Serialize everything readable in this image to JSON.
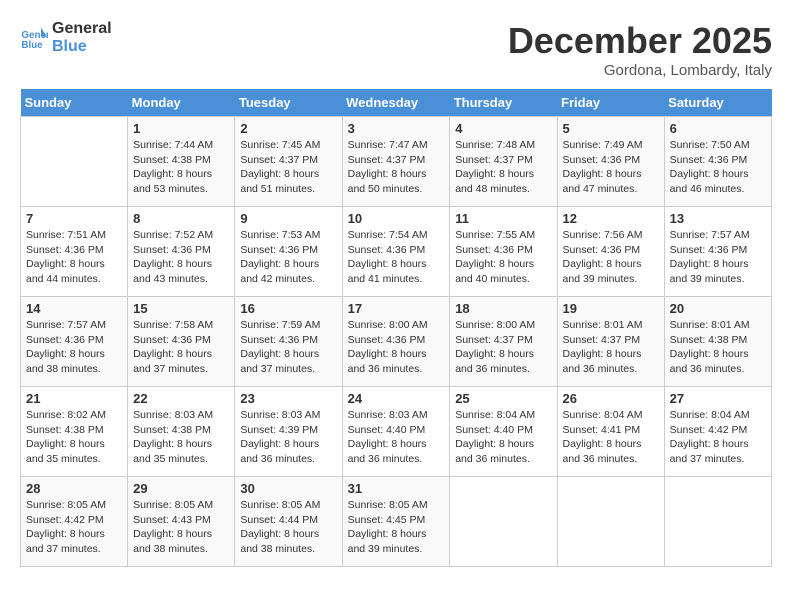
{
  "logo": {
    "line1": "General",
    "line2": "Blue"
  },
  "title": "December 2025",
  "location": "Gordona, Lombardy, Italy",
  "days_header": [
    "Sunday",
    "Monday",
    "Tuesday",
    "Wednesday",
    "Thursday",
    "Friday",
    "Saturday"
  ],
  "weeks": [
    [
      {
        "day": "",
        "sunrise": "",
        "sunset": "",
        "daylight": ""
      },
      {
        "day": "1",
        "sunrise": "7:44 AM",
        "sunset": "4:38 PM",
        "daylight": "8 hours and 53 minutes."
      },
      {
        "day": "2",
        "sunrise": "7:45 AM",
        "sunset": "4:37 PM",
        "daylight": "8 hours and 51 minutes."
      },
      {
        "day": "3",
        "sunrise": "7:47 AM",
        "sunset": "4:37 PM",
        "daylight": "8 hours and 50 minutes."
      },
      {
        "day": "4",
        "sunrise": "7:48 AM",
        "sunset": "4:37 PM",
        "daylight": "8 hours and 48 minutes."
      },
      {
        "day": "5",
        "sunrise": "7:49 AM",
        "sunset": "4:36 PM",
        "daylight": "8 hours and 47 minutes."
      },
      {
        "day": "6",
        "sunrise": "7:50 AM",
        "sunset": "4:36 PM",
        "daylight": "8 hours and 46 minutes."
      }
    ],
    [
      {
        "day": "7",
        "sunrise": "7:51 AM",
        "sunset": "4:36 PM",
        "daylight": "8 hours and 44 minutes."
      },
      {
        "day": "8",
        "sunrise": "7:52 AM",
        "sunset": "4:36 PM",
        "daylight": "8 hours and 43 minutes."
      },
      {
        "day": "9",
        "sunrise": "7:53 AM",
        "sunset": "4:36 PM",
        "daylight": "8 hours and 42 minutes."
      },
      {
        "day": "10",
        "sunrise": "7:54 AM",
        "sunset": "4:36 PM",
        "daylight": "8 hours and 41 minutes."
      },
      {
        "day": "11",
        "sunrise": "7:55 AM",
        "sunset": "4:36 PM",
        "daylight": "8 hours and 40 minutes."
      },
      {
        "day": "12",
        "sunrise": "7:56 AM",
        "sunset": "4:36 PM",
        "daylight": "8 hours and 39 minutes."
      },
      {
        "day": "13",
        "sunrise": "7:57 AM",
        "sunset": "4:36 PM",
        "daylight": "8 hours and 39 minutes."
      }
    ],
    [
      {
        "day": "14",
        "sunrise": "7:57 AM",
        "sunset": "4:36 PM",
        "daylight": "8 hours and 38 minutes."
      },
      {
        "day": "15",
        "sunrise": "7:58 AM",
        "sunset": "4:36 PM",
        "daylight": "8 hours and 37 minutes."
      },
      {
        "day": "16",
        "sunrise": "7:59 AM",
        "sunset": "4:36 PM",
        "daylight": "8 hours and 37 minutes."
      },
      {
        "day": "17",
        "sunrise": "8:00 AM",
        "sunset": "4:36 PM",
        "daylight": "8 hours and 36 minutes."
      },
      {
        "day": "18",
        "sunrise": "8:00 AM",
        "sunset": "4:37 PM",
        "daylight": "8 hours and 36 minutes."
      },
      {
        "day": "19",
        "sunrise": "8:01 AM",
        "sunset": "4:37 PM",
        "daylight": "8 hours and 36 minutes."
      },
      {
        "day": "20",
        "sunrise": "8:01 AM",
        "sunset": "4:38 PM",
        "daylight": "8 hours and 36 minutes."
      }
    ],
    [
      {
        "day": "21",
        "sunrise": "8:02 AM",
        "sunset": "4:38 PM",
        "daylight": "8 hours and 35 minutes."
      },
      {
        "day": "22",
        "sunrise": "8:03 AM",
        "sunset": "4:38 PM",
        "daylight": "8 hours and 35 minutes."
      },
      {
        "day": "23",
        "sunrise": "8:03 AM",
        "sunset": "4:39 PM",
        "daylight": "8 hours and 36 minutes."
      },
      {
        "day": "24",
        "sunrise": "8:03 AM",
        "sunset": "4:40 PM",
        "daylight": "8 hours and 36 minutes."
      },
      {
        "day": "25",
        "sunrise": "8:04 AM",
        "sunset": "4:40 PM",
        "daylight": "8 hours and 36 minutes."
      },
      {
        "day": "26",
        "sunrise": "8:04 AM",
        "sunset": "4:41 PM",
        "daylight": "8 hours and 36 minutes."
      },
      {
        "day": "27",
        "sunrise": "8:04 AM",
        "sunset": "4:42 PM",
        "daylight": "8 hours and 37 minutes."
      }
    ],
    [
      {
        "day": "28",
        "sunrise": "8:05 AM",
        "sunset": "4:42 PM",
        "daylight": "8 hours and 37 minutes."
      },
      {
        "day": "29",
        "sunrise": "8:05 AM",
        "sunset": "4:43 PM",
        "daylight": "8 hours and 38 minutes."
      },
      {
        "day": "30",
        "sunrise": "8:05 AM",
        "sunset": "4:44 PM",
        "daylight": "8 hours and 38 minutes."
      },
      {
        "day": "31",
        "sunrise": "8:05 AM",
        "sunset": "4:45 PM",
        "daylight": "8 hours and 39 minutes."
      },
      {
        "day": "",
        "sunrise": "",
        "sunset": "",
        "daylight": ""
      },
      {
        "day": "",
        "sunrise": "",
        "sunset": "",
        "daylight": ""
      },
      {
        "day": "",
        "sunrise": "",
        "sunset": "",
        "daylight": ""
      }
    ]
  ]
}
